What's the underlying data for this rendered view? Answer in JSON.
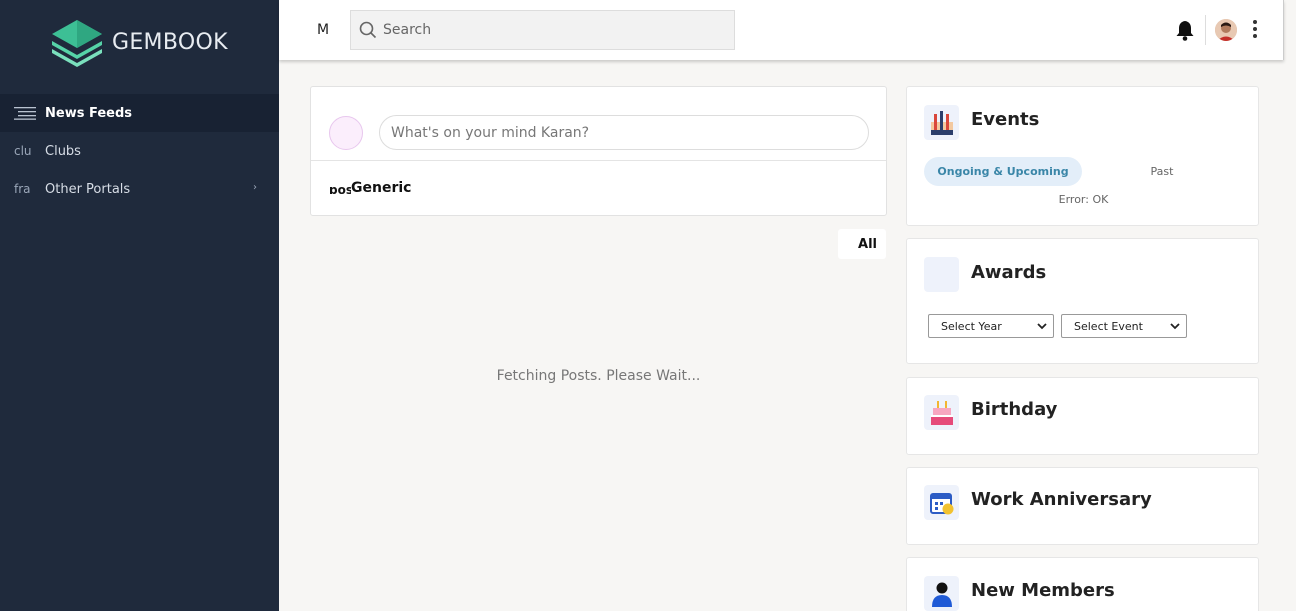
{
  "brand": {
    "name": "GEMBOOK"
  },
  "sidebar": {
    "items": [
      {
        "icon_text": "",
        "label": "News Feeds",
        "active": true
      },
      {
        "icon_text": "clu",
        "label": "Clubs"
      },
      {
        "icon_text": "fra",
        "label": "Other Portals",
        "chevron": "›"
      }
    ]
  },
  "topbar": {
    "menu_letter": "M",
    "search_placeholder": "Search"
  },
  "composer": {
    "placeholder": "What's on your mind Karan?",
    "tab_icon_text": "pos",
    "tab_label": "Generic"
  },
  "feed": {
    "filter_label": "All",
    "loading_text": "Fetching Posts. Please Wait..."
  },
  "events": {
    "title": "Events",
    "tab_active": "Ongoing & Upcoming",
    "tab_inactive": "Past",
    "status": "Error: OK"
  },
  "awards": {
    "title": "Awards",
    "year_select": "Select Year",
    "event_select": "Select Event"
  },
  "birthday": {
    "title": "Birthday"
  },
  "anniversary": {
    "title": "Work Anniversary"
  },
  "members": {
    "title": "New Members"
  },
  "colors": {
    "sidebar_bg": "#1f2a3c",
    "accent": "#3a86a8",
    "tab_bg": "#e3eef9"
  },
  "icons": [
    "layers-logo-icon",
    "menu-icon",
    "search-icon",
    "bell-icon",
    "kebab-icon",
    "events-icon",
    "awards-icon",
    "cake-icon",
    "calendar-icon",
    "person-icon"
  ]
}
